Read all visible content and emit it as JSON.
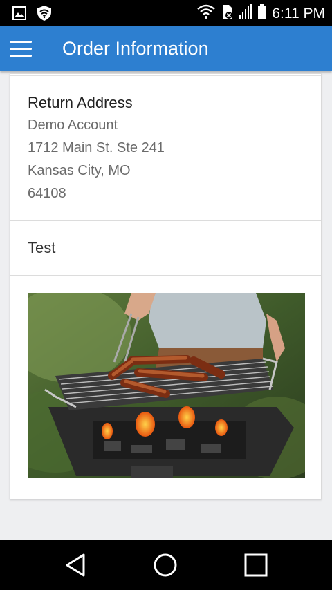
{
  "status_bar": {
    "time": "6:11 PM",
    "icons": [
      "image-notification-icon",
      "shield-wifi-icon",
      "wifi-icon",
      "sim-icon",
      "signal-icon",
      "battery-icon"
    ]
  },
  "app_bar": {
    "title": "Order Information",
    "menu_icon": "hamburger-menu-icon",
    "color": "#2d7fd0"
  },
  "return_address": {
    "title": "Return Address",
    "lines": [
      "Demo Account",
      "1712 Main St. Ste 241",
      "Kansas City, MO",
      "64108"
    ]
  },
  "note": "Test",
  "photo": {
    "content": "hot dogs grilling on a barbecue"
  },
  "nav_bar": {
    "buttons": [
      "back-icon",
      "home-icon",
      "recents-icon"
    ]
  }
}
